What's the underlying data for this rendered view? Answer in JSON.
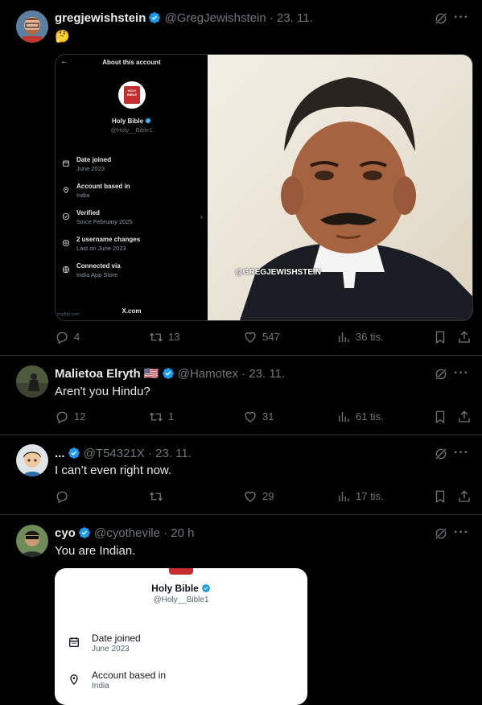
{
  "posts": [
    {
      "name": "gregjewishstein",
      "handle": "@GregJewishstein",
      "date": "· 23. 11.",
      "text": "🤔",
      "replies": "4",
      "reposts": "13",
      "likes": "547",
      "views": "36 tis."
    },
    {
      "name": "Malietoa Elryth",
      "flag": "🇺🇸",
      "handle": "@Hamotex",
      "date": "· 23. 11.",
      "text": "Aren't you Hindu?",
      "replies": "12",
      "reposts": "1",
      "likes": "31",
      "views": "61 tis."
    },
    {
      "name": "...",
      "handle": "@T54321X",
      "date": "· 23. 11.",
      "text": "I can’t even right now.",
      "replies": "",
      "reposts": "",
      "likes": "29",
      "views": "17 tis."
    },
    {
      "name": "cyo",
      "handle": "@cyothevile",
      "date": "· 20 h",
      "text": "You are Indian."
    }
  ],
  "about_card": {
    "title": "About this account",
    "name": "Holy Bible",
    "handle": "@Holy__Bible1",
    "logo_text": "HOLY BIBLE",
    "rows": [
      {
        "label": "Date joined",
        "value": "June 2023",
        "icon": "calendar-icon"
      },
      {
        "label": "Account based in",
        "value": "India",
        "icon": "location-pin-icon"
      },
      {
        "label": "Verified",
        "value": "Since February 2025",
        "icon": "verified-check-icon"
      },
      {
        "label": "2 username changes",
        "value": "Last on June 2023",
        "icon": "at-sign-icon"
      },
      {
        "label": "Connected via",
        "value": "India App Store",
        "icon": "globe-icon"
      }
    ],
    "footer": "X.com",
    "imgflip": "imgflip.com",
    "watermark": "@GREGJEWISHSTEIN"
  },
  "white_card": {
    "name": "Holy Bible",
    "handle": "@Holy__Bible1",
    "rows": [
      {
        "label": "Date joined",
        "value": "June 2023",
        "icon": "calendar-icon"
      },
      {
        "label": "Account based in",
        "value": "India",
        "icon": "location-pin-icon"
      }
    ]
  },
  "colors": {
    "verified": "#1d9bf0",
    "muted": "#71767b",
    "bg": "#000000"
  }
}
